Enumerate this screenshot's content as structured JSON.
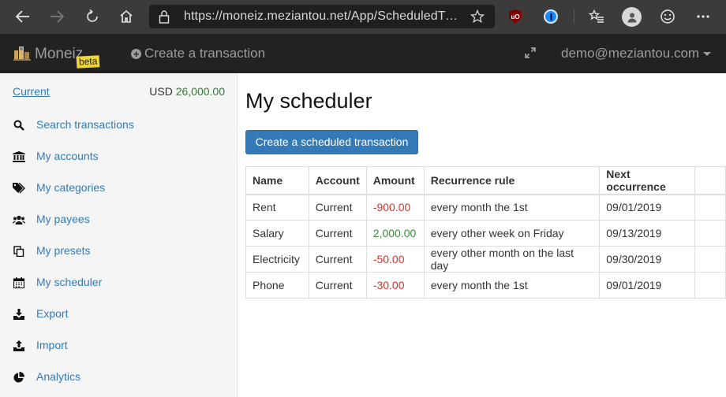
{
  "browser": {
    "url": "https://moneiz.meziantou.net/App/ScheduledTr…"
  },
  "navbar": {
    "brand": "Moneiz",
    "beta_badge": "beta",
    "create_transaction": "Create a transaction",
    "user": "demo@meziantou.com"
  },
  "sidebar": {
    "account_name": "Current",
    "currency": "USD",
    "balance": "26,000.00",
    "items": [
      {
        "label": "Search transactions",
        "icon": "search-icon"
      },
      {
        "label": "My accounts",
        "icon": "bank-icon"
      },
      {
        "label": "My categories",
        "icon": "tags-icon"
      },
      {
        "label": "My payees",
        "icon": "users-icon"
      },
      {
        "label": "My presets",
        "icon": "copy-icon"
      },
      {
        "label": "My scheduler",
        "icon": "calendar-icon"
      },
      {
        "label": "Export",
        "icon": "download-icon"
      },
      {
        "label": "Import",
        "icon": "upload-icon"
      },
      {
        "label": "Analytics",
        "icon": "pie-chart-icon"
      }
    ]
  },
  "main": {
    "title": "My scheduler",
    "create_button": "Create a scheduled transaction",
    "table": {
      "headers": [
        "Name",
        "Account",
        "Amount",
        "Recurrence rule",
        "Next occurrence"
      ],
      "rows": [
        {
          "name": "Rent",
          "account": "Current",
          "amount": "-900.00",
          "rule": "every month the 1st",
          "next": "09/01/2019"
        },
        {
          "name": "Salary",
          "account": "Current",
          "amount": "2,000.00",
          "rule": "every other week on Friday",
          "next": "09/13/2019"
        },
        {
          "name": "Electricity",
          "account": "Current",
          "amount": "-50.00",
          "rule": "every other month on the last day",
          "next": "09/30/2019"
        },
        {
          "name": "Phone",
          "account": "Current",
          "amount": "-30.00",
          "rule": "every month the 1st",
          "next": "09/01/2019"
        }
      ]
    }
  },
  "colors": {
    "link": "#337ab7",
    "negative": "#d9302c",
    "positive": "#3c8a3c",
    "navbar": "#222222"
  }
}
